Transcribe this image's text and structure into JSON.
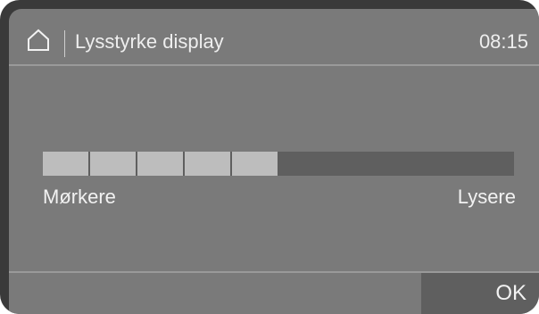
{
  "header": {
    "title": "Lysstyrke display",
    "time": "08:15",
    "home_icon": "home-icon"
  },
  "brightness": {
    "level": 5,
    "max_level": 10,
    "label_min": "Mørkere",
    "label_max": "Lysere"
  },
  "footer": {
    "ok_label": "OK"
  },
  "colors": {
    "screen": "#7a7a7a",
    "bar_empty": "#5f5f5f",
    "bar_filled": "#bdbdbd",
    "text": "#f2f2f2"
  }
}
